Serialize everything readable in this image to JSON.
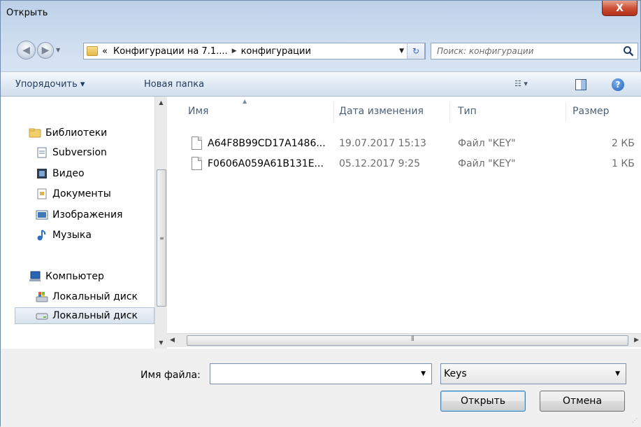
{
  "window": {
    "title": "Открыть",
    "close_glyph": "X"
  },
  "nav": {
    "breadcrumbs": [
      "«",
      "Конфигурации на 7.1....",
      "конфигурации"
    ],
    "search_placeholder": "Поиск: конфигурации"
  },
  "toolbar": {
    "organize_label": "Упорядочить ▾",
    "new_folder_label": "Новая папка"
  },
  "sidebar": {
    "items": [
      {
        "label": "Библиотеки",
        "icon": "libraries-icon"
      },
      {
        "label": "Subversion",
        "icon": "document-icon"
      },
      {
        "label": "Видео",
        "icon": "video-icon"
      },
      {
        "label": "Документы",
        "icon": "documents-icon"
      },
      {
        "label": "Изображения",
        "icon": "pictures-icon"
      },
      {
        "label": "Музыка",
        "icon": "music-icon"
      },
      {
        "label": "Компьютер",
        "icon": "computer-icon"
      },
      {
        "label": "Локальный диск",
        "icon": "system-drive-icon"
      },
      {
        "label": "Локальный диск",
        "icon": "drive-icon",
        "selected": true
      }
    ]
  },
  "files": {
    "columns": [
      "Имя",
      "Дата изменения",
      "Тип",
      "Размер"
    ],
    "rows": [
      {
        "name": "A64F8B99CD17A1486...",
        "date": "19.07.2017 15:13",
        "type": "Файл \"KEY\"",
        "size": "2 КБ"
      },
      {
        "name": "F0606A059A61B131E...",
        "date": "05.12.2017 9:25",
        "type": "Файл \"KEY\"",
        "size": "1 КБ"
      }
    ]
  },
  "footer": {
    "filename_label": "Имя файла:",
    "filename_value": "",
    "filetype_value": "Keys",
    "open_label": "Открыть",
    "cancel_label": "Отмена"
  }
}
